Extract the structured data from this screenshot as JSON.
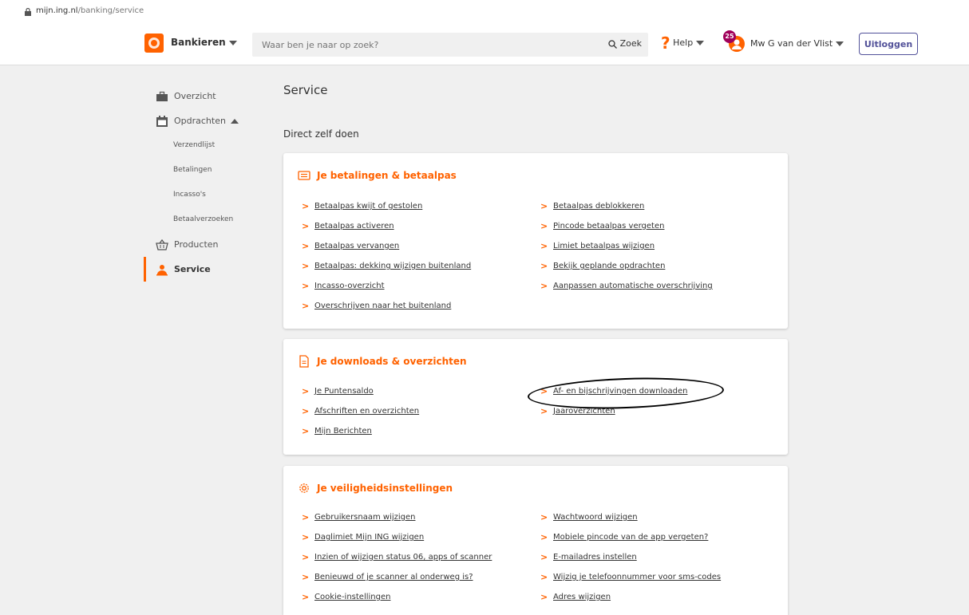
{
  "browser": {
    "url_host": "mijn.ing.nl",
    "url_path": "/banking/service"
  },
  "header": {
    "bankieren_label": "Bankieren",
    "search_placeholder": "Waar ben je naar op zoek?",
    "search_button": "Zoek",
    "help_label": "Help",
    "notification_count": "25",
    "user_name": "Mw G van der Vlist",
    "logout_label": "Uitloggen",
    "brand_color": "#ff6200"
  },
  "sidebar": {
    "overzicht": "Overzicht",
    "opdrachten": "Opdrachten",
    "sub_items": [
      "Verzendlijst",
      "Betalingen",
      "Incasso's",
      "Betaalverzoeken"
    ],
    "producten": "Producten",
    "service": "Service"
  },
  "main": {
    "title": "Service",
    "subtitle": "Direct zelf doen",
    "cards": [
      {
        "title": "Je betalingen & betaalpas",
        "icon": "card-icon",
        "left": [
          "Betaalpas kwijt of gestolen",
          "Betaalpas activeren",
          "Betaalpas vervangen",
          "Betaalpas: dekking wijzigen buitenland",
          "Incasso-overzicht",
          "Overschrijven naar het buitenland"
        ],
        "right": [
          "Betaalpas deblokkeren",
          "Pincode betaalpas vergeten",
          "Limiet betaalpas wijzigen",
          "Bekijk geplande opdrachten",
          "Aanpassen automatische overschrijving"
        ]
      },
      {
        "title": "Je downloads & overzichten",
        "icon": "document-icon",
        "left": [
          "Je Puntensaldo",
          "Afschriften en overzichten",
          "Mijn Berichten"
        ],
        "right": [
          "Af- en bijschrijvingen downloaden",
          "Jaaroverzichten"
        ]
      },
      {
        "title": "Je veiligheidsinstellingen",
        "icon": "gear-icon",
        "left": [
          "Gebruikersnaam wijzigen",
          "Daglimiet Mijn ING wijzigen",
          "Inzien of wijzigen status 06, apps of scanner",
          "Benieuwd of je scanner al onderweg is?",
          "Cookie-instellingen"
        ],
        "right": [
          "Wachtwoord wijzigen",
          "Mobiele pincode van de app vergeten?",
          "E-mailadres instellen",
          "Wijzig je telefoonnummer voor sms-codes",
          "Adres wijzigen"
        ]
      }
    ]
  }
}
